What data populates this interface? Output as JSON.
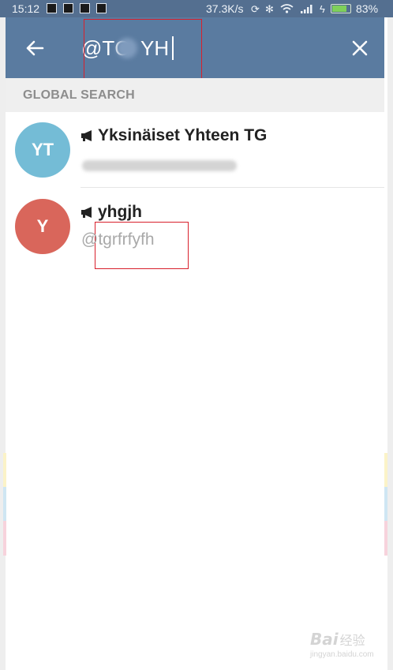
{
  "status_bar": {
    "time": "15:12",
    "net_speed": "37.3K/s",
    "battery_pct": "83%",
    "battery_level": 0.83,
    "icons": [
      "notification-icon-1",
      "notification-icon-2",
      "notification-icon-3",
      "notification-icon-4",
      "sync-icon",
      "bluetooth-icon",
      "wifi-icon",
      "signal-icon",
      "charging-icon",
      "battery-icon"
    ]
  },
  "toolbar": {
    "back_icon": "arrow-left-icon",
    "search_value": "@TC  YH",
    "close_icon": "close-icon",
    "color": "#5a7ba0"
  },
  "section": {
    "title": "GLOBAL SEARCH"
  },
  "results": [
    {
      "initials": "YT",
      "avatar_color": "#74bcd6",
      "icon": "megaphone-icon",
      "name": "Yksinäiset Yhteen TG",
      "subtitle_redacted": true
    },
    {
      "initials": "Y",
      "avatar_color": "#d9665b",
      "icon": "megaphone-icon",
      "name": "yhgjh",
      "subtitle": "@tgrfrfyfh"
    }
  ],
  "watermark": {
    "brand": "Bai",
    "brand_suffix": "经验",
    "url": "jingyan.baidu.com"
  }
}
